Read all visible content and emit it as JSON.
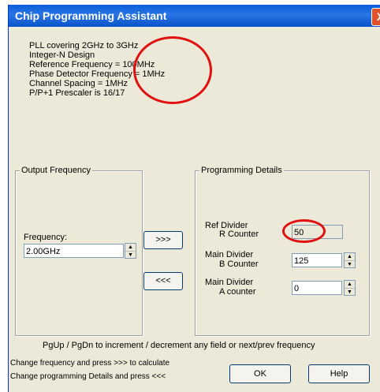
{
  "window": {
    "title": "Chip Programming Assistant",
    "close_glyph": "X"
  },
  "info_lines": [
    "PLL covering  2GHz to  3GHz",
    "Integer-N Design",
    "Reference Frequency = 100MHz",
    "Phase Detector Frequency = 1MHz",
    "Channel Spacing =  1MHz",
    "P/P+1 Prescaler is 16/17"
  ],
  "output_frequency": {
    "legend": "Output Frequency",
    "frequency_label": "Frequency:",
    "frequency_value": "2.00GHz"
  },
  "buttons": {
    "calculate": ">>>",
    "reverse": "<<<",
    "ok": "OK",
    "help": "Help"
  },
  "programming_details": {
    "legend": "Programming Details",
    "ref_divider_label_1": "Ref Divider",
    "ref_divider_label_2": "R Counter",
    "ref_divider_value": "50",
    "main_b_label_1": "Main Divider",
    "main_b_label_2": "B Counter",
    "main_b_value": "125",
    "main_a_label_1": "Main Divider",
    "main_a_label_2": "A counter",
    "main_a_value": "0"
  },
  "footer": {
    "hint": "PgUp / PgDn to increment / decrement any field or next/prev frequency",
    "line1": "Change frequency and press >>> to calculate",
    "line2": "Change programming Details and press <<<"
  },
  "colors": {
    "annotation_circle": "#e01010",
    "titlebar": "#0a5fd8",
    "dialog_bg": "#ece9d8"
  },
  "icons": {
    "spin_up": "▲",
    "spin_down": "▼"
  }
}
